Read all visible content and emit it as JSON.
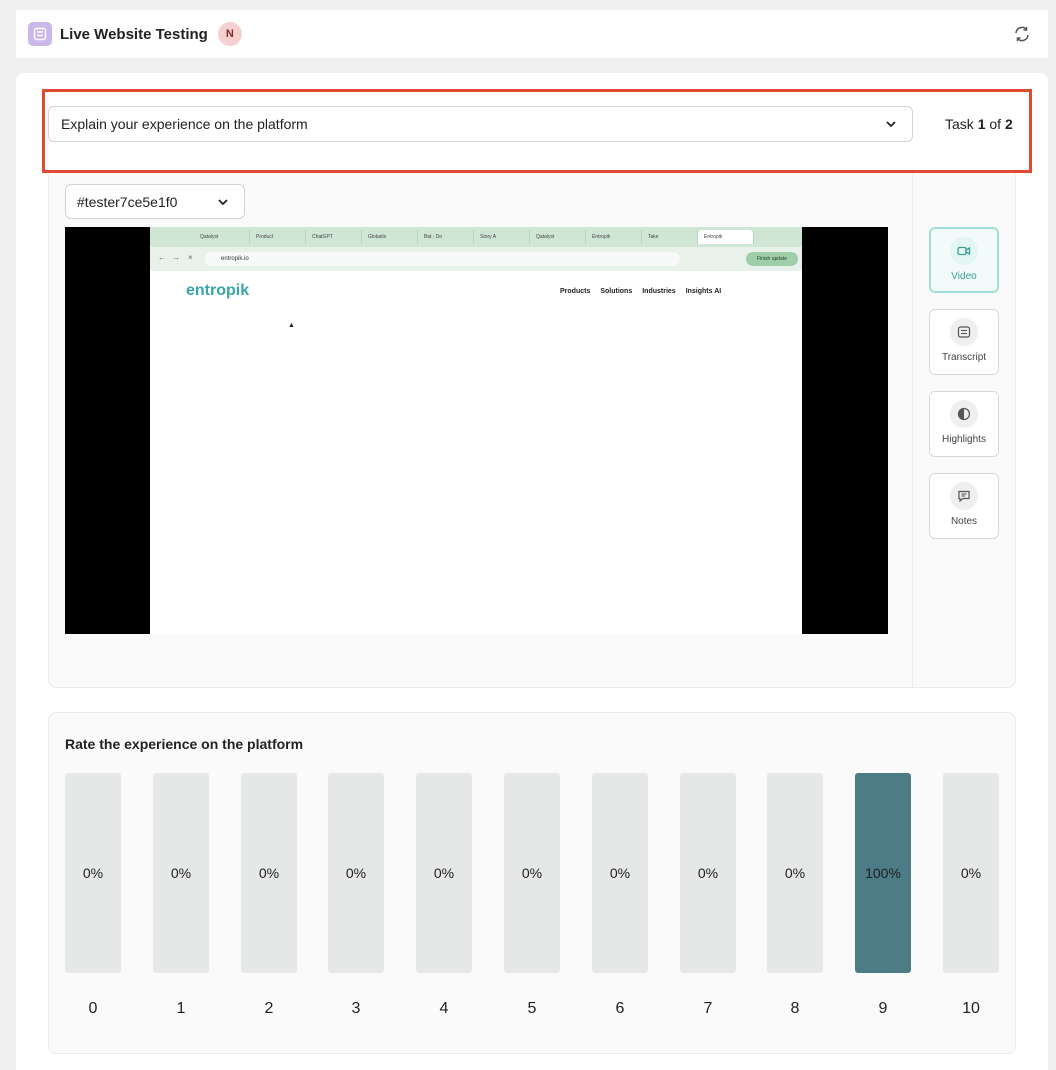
{
  "header": {
    "app_icon": "clipboard-icon",
    "title": "Live Website Testing",
    "avatar_initial": "N",
    "refresh_icon": "refresh-icon"
  },
  "task": {
    "selected": "Explain your experience on the platform",
    "counter_prefix": "Task",
    "current": "1",
    "of_word": "of",
    "total": "2"
  },
  "tester": {
    "selected": "#tester7ce5e1f0"
  },
  "video": {
    "tabs": [
      "Qatalyst",
      "Product",
      "ChatGPT",
      "Globalis",
      "Bat : Do",
      "Story A",
      "Qatalyst",
      "Entropik",
      "Take",
      "Entropik"
    ],
    "url": "entropik.io",
    "finish_label": "Finish update",
    "site_logo": "entropik",
    "site_nav": [
      "Products",
      "Solutions",
      "Industries",
      "Insights AI"
    ]
  },
  "side_panel": [
    {
      "id": "video",
      "label": "Video",
      "icon": "video-camera-icon",
      "active": true
    },
    {
      "id": "transcript",
      "label": "Transcript",
      "icon": "transcript-icon",
      "active": false
    },
    {
      "id": "highlights",
      "label": "Highlights",
      "icon": "highlights-icon",
      "active": false
    },
    {
      "id": "notes",
      "label": "Notes",
      "icon": "notes-icon",
      "active": false
    }
  ],
  "rating": {
    "title": "Rate the experience on the platform",
    "options": [
      {
        "label": "0",
        "percent": "0%"
      },
      {
        "label": "1",
        "percent": "0%"
      },
      {
        "label": "2",
        "percent": "0%"
      },
      {
        "label": "3",
        "percent": "0%"
      },
      {
        "label": "4",
        "percent": "0%"
      },
      {
        "label": "5",
        "percent": "0%"
      },
      {
        "label": "6",
        "percent": "0%"
      },
      {
        "label": "7",
        "percent": "0%"
      },
      {
        "label": "8",
        "percent": "0%"
      },
      {
        "label": "9",
        "percent": "100%"
      },
      {
        "label": "10",
        "percent": "0%"
      }
    ],
    "selected_index": 9
  },
  "colors": {
    "highlight_border": "#e04a2f",
    "selected_bar": "#4d7c87",
    "accent": "#3a9e94"
  }
}
